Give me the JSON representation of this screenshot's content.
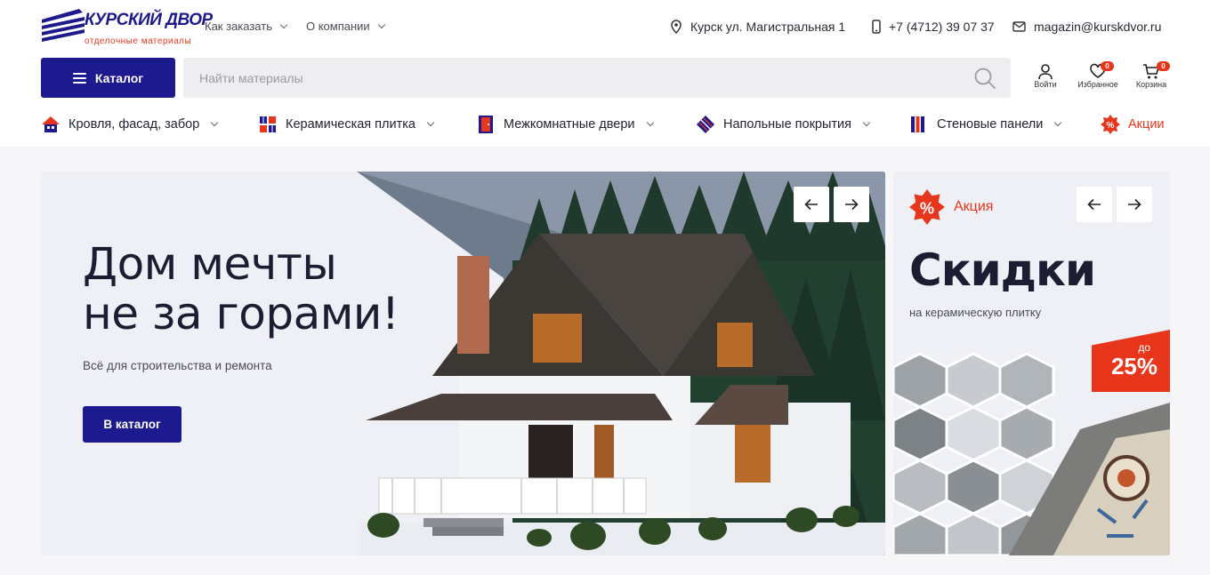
{
  "brand": {
    "name": "КУРСКИЙ ДВОР",
    "tagline": "отделочные материалы",
    "primary_color": "#1c1a8e",
    "accent_color": "#e8361c"
  },
  "topnav": [
    {
      "label": "Как заказать"
    },
    {
      "label": "О компании"
    }
  ],
  "contacts": {
    "address": "Курск ул. Магистральная 1",
    "phone": "+7 (4712) 39 07 37",
    "email": "magazin@kurskdvor.ru"
  },
  "header": {
    "catalog_label": "Каталог",
    "search_placeholder": "Найти материалы",
    "login_label": "Войти",
    "favorites_label": "Избранное",
    "favorites_count": "0",
    "cart_label": "Корзина",
    "cart_count": "0"
  },
  "categories": [
    {
      "label": "Кровля, фасад, забор",
      "icon": "roof-icon"
    },
    {
      "label": "Керамическая плитка",
      "icon": "tile-icon"
    },
    {
      "label": "Межкомнатные двери",
      "icon": "door-icon"
    },
    {
      "label": "Напольные покрытия",
      "icon": "floor-icon"
    },
    {
      "label": "Стеновые панели",
      "icon": "panel-icon"
    },
    {
      "label": "Акции",
      "icon": "percent-icon"
    }
  ],
  "hero": {
    "title_line1": "Дом мечты",
    "title_line2": "не за горами!",
    "subtitle": "Всё для строительства и ремонта",
    "button_label": "В каталог"
  },
  "promo": {
    "tag": "Акция",
    "title": "Скидки",
    "subtitle": "на керамическую плитку",
    "discount_prefix": "до",
    "discount_value": "25%"
  }
}
